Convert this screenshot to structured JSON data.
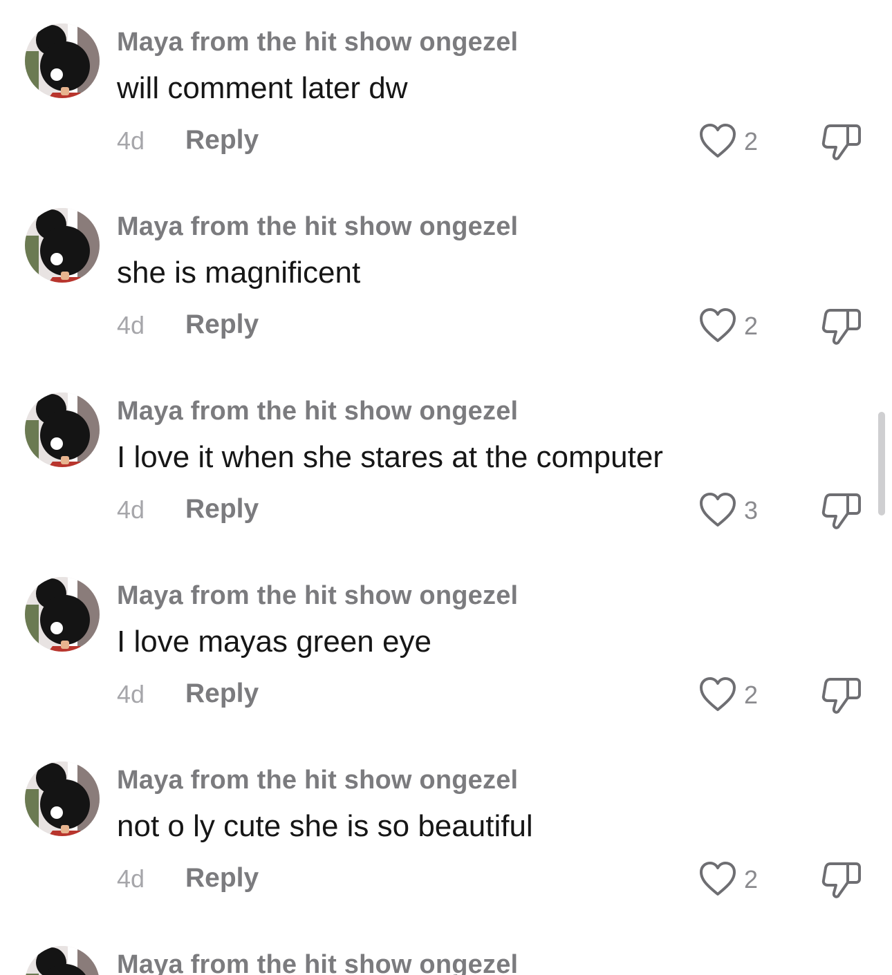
{
  "comments": [
    {
      "username": "Maya from the hit show ongezel",
      "text": "will comment later dw",
      "time": "4d",
      "reply_label": "Reply",
      "likes": "2"
    },
    {
      "username": "Maya from the hit show ongezel",
      "text": "she is magnificent",
      "time": "4d",
      "reply_label": "Reply",
      "likes": "2"
    },
    {
      "username": "Maya from the hit show ongezel",
      "text": "I love it when she stares at the computer",
      "time": "4d",
      "reply_label": "Reply",
      "likes": "3"
    },
    {
      "username": "Maya from the hit show ongezel",
      "text": "I love mayas green eye",
      "time": "4d",
      "reply_label": "Reply",
      "likes": "2"
    },
    {
      "username": "Maya from the hit show ongezel",
      "text": "not o ly cute she is so beautiful",
      "time": "4d",
      "reply_label": "Reply",
      "likes": "2"
    },
    {
      "username": "Maya from the hit show ongezel"
    }
  ],
  "icons": {
    "like": "heart-outline-icon",
    "dislike": "thumbs-down-outline-icon"
  },
  "colors": {
    "username": "#7b7b7e",
    "text": "#161616",
    "time": "#a6a6aa",
    "icon": "#6e6e72"
  }
}
